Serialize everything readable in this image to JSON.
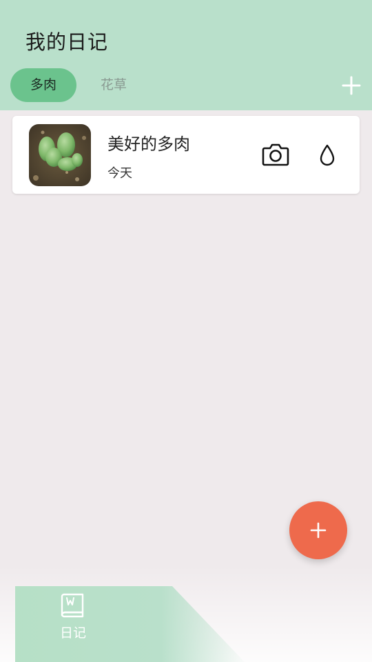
{
  "header": {
    "title": "我的日记",
    "background_color": "#b9e0cb",
    "tabs": [
      {
        "label": "多肉",
        "active": true
      },
      {
        "label": "花草",
        "active": false
      }
    ],
    "add_icon": "plus-icon"
  },
  "diary_list": [
    {
      "title": "美好的多肉",
      "date": "今天",
      "thumbnail": "succulent-photo",
      "actions": [
        "camera-icon",
        "water-drop-icon"
      ]
    }
  ],
  "fab": {
    "icon": "plus-icon",
    "color": "#ee6a4c"
  },
  "bottom_nav": {
    "items": [
      {
        "label": "日记",
        "icon": "book-icon",
        "active": true
      }
    ]
  }
}
